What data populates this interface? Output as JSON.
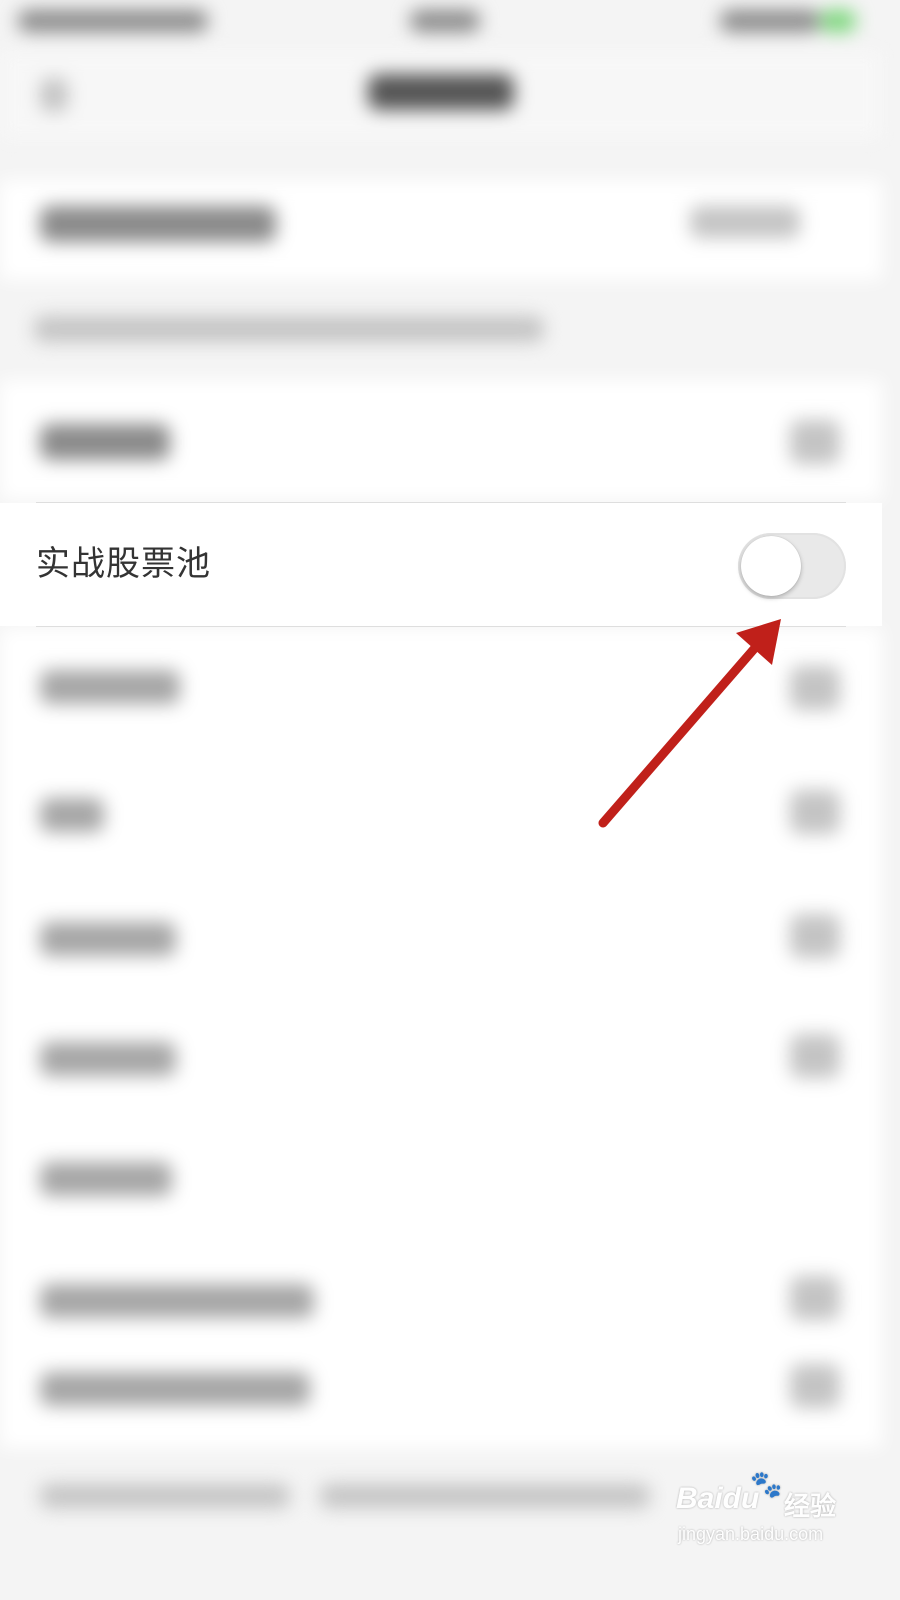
{
  "setting_row": {
    "label": "实战股票池",
    "toggle_on": false
  },
  "colors": {
    "arrow": "#c0201a",
    "toggle_track_off": "#e9e9e9",
    "toggle_knob": "#ffffff"
  },
  "watermark": {
    "logo": "Baidu",
    "paw_icon": "paw-icon",
    "brand": "经验",
    "url": "jingyan.baidu.com"
  }
}
